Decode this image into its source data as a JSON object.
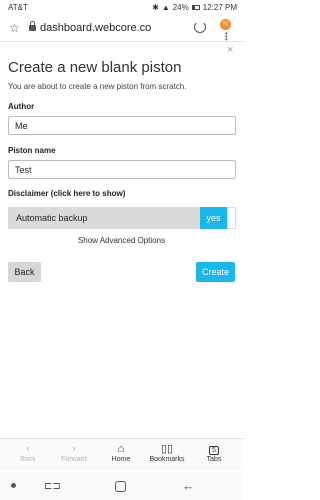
{
  "status_bar": {
    "carrier": "AT&T",
    "battery": "24%",
    "time": "12:27 PM"
  },
  "browser": {
    "url": "dashboard.webcore.co",
    "avatar_letter": "N"
  },
  "dialog": {
    "close": "×",
    "title": "Create a new blank piston",
    "subtitle": "You are about to create a new piston from scratch.",
    "author_label": "Author",
    "author_value": "Me",
    "name_label": "Piston name",
    "name_value": "Test",
    "disclaimer": "Disclaimer (click here to show)",
    "backup_label": "Automatic backup",
    "backup_toggle": "yes",
    "advanced": "Show Advanced Options",
    "back_button": "Back",
    "create_button": "Create"
  },
  "bottom_bar": {
    "back": "Back",
    "forward": "Forward",
    "home": "Home",
    "bookmarks": "Bookmarks",
    "tabs": "Tabs",
    "tabs_count": "5"
  },
  "colors": {
    "accent": "#1ab7ea",
    "avatar": "#f58a2e"
  }
}
